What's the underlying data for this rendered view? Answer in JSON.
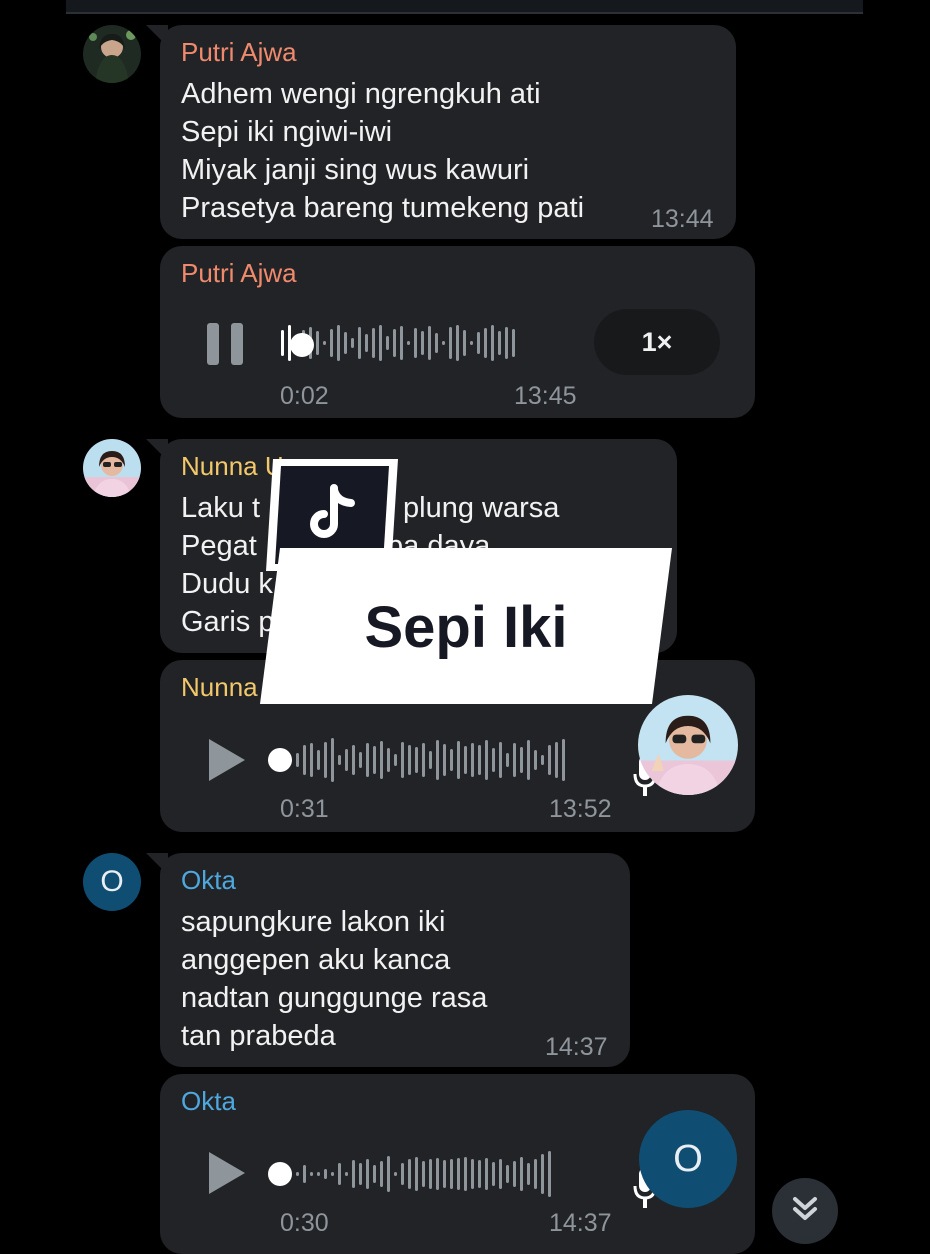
{
  "colors": {
    "background": "#000000",
    "bubble": "#212326",
    "sender_putri": "#f08a6c",
    "sender_nunna": "#f2c86b",
    "sender_okta": "#4ea8de",
    "muted_text": "#8e959b",
    "okta_avatar": "#0f4e72"
  },
  "messages": [
    {
      "sender": "Putri Ajwa",
      "text": "Adhem wengi ngrengkuh ati\nSepi iki ngiwi-iwi\nMiyak janji sing wus kawuri\nPrasetya bareng tumekeng pati",
      "time": "13:44"
    },
    {
      "sender": "Putri Ajwa",
      "voice": {
        "state": "playing",
        "icon": "pause-icon",
        "duration": "0:02",
        "time": "13:45",
        "speed": "1×",
        "progress": 0.05
      }
    },
    {
      "sender": "Nunna Uswatah",
      "sender_visible": "Nunna U",
      "text": "Laku tan mlupolung warsa\nPegat tanpa daya\nDudu kang\nGaris pinesthi",
      "text_visible": [
        "Laku t",
        "plung warsa",
        "Pegat",
        "pa daya",
        "Dudu k",
        "Garis p"
      ],
      "time": ""
    },
    {
      "sender": "Nunna",
      "voice": {
        "state": "paused",
        "icon": "play-icon",
        "duration": "0:31",
        "time": "13:52",
        "progress": 0.0
      }
    },
    {
      "sender": "Okta",
      "avatar_letter": "O",
      "text": "sapungkure lakon iki\nanggepen aku kanca\nnadtan gunggunge rasa\ntan prabeda",
      "time": "14:37"
    },
    {
      "sender": "Okta",
      "avatar_letter": "O",
      "voice": {
        "state": "paused",
        "icon": "play-icon",
        "duration": "0:30",
        "time": "14:37",
        "progress": 0.0
      }
    }
  ],
  "overlay": {
    "title": "Sepi Iki",
    "logo": "tiktok-logo-icon"
  },
  "scroll_down_icon": "double-chevron-down-icon"
}
